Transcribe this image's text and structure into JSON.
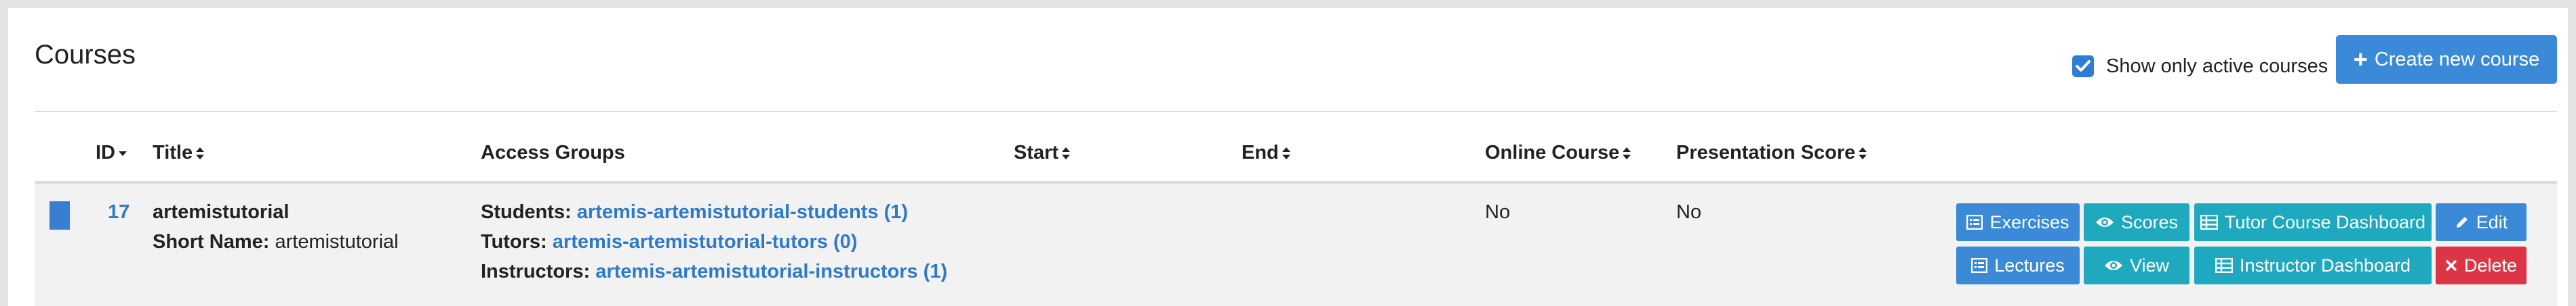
{
  "page": {
    "title": "Courses"
  },
  "toolbar": {
    "show_active_label": "Show only active courses",
    "show_active_checked": true,
    "create_label": "Create new course"
  },
  "table": {
    "columns": [
      {
        "label": "ID",
        "sort": "desc"
      },
      {
        "label": "Title",
        "sort": "both"
      },
      {
        "label": "Access Groups",
        "sort": "none"
      },
      {
        "label": "Start",
        "sort": "both"
      },
      {
        "label": "End",
        "sort": "both"
      },
      {
        "label": "Online Course",
        "sort": "both"
      },
      {
        "label": "Presentation Score",
        "sort": "both"
      }
    ],
    "rows": [
      {
        "id": "17",
        "title": "artemistutorial",
        "short_name_label": "Short Name:",
        "short_name": "artemistutorial",
        "groups": [
          {
            "label": "Students:",
            "value": "artemis-artemistutorial-students (1)"
          },
          {
            "label": "Tutors:",
            "value": "artemis-artemistutorial-tutors (0)"
          },
          {
            "label": "Instructors:",
            "value": "artemis-artemistutorial-instructors (1)"
          }
        ],
        "start": "",
        "end": "",
        "online_course": "No",
        "presentation_score": "No",
        "actions": {
          "exercises": "Exercises",
          "scores": "Scores",
          "tutor_dashboard": "Tutor Course Dashboard",
          "edit": "Edit",
          "lectures": "Lectures",
          "view": "View",
          "instructor_dashboard": "Instructor Dashboard",
          "delete": "Delete"
        }
      }
    ]
  },
  "colors": {
    "primary": "#3a8ad8",
    "info": "#1ea9bf",
    "danger": "#dc3545",
    "link": "#2f7ac8"
  }
}
